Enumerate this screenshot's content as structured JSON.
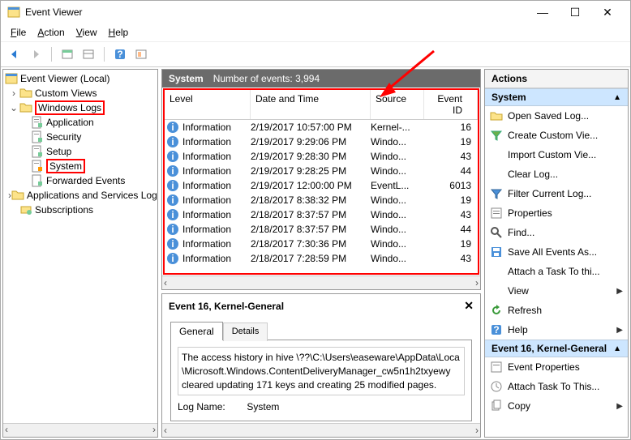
{
  "window": {
    "title": "Event Viewer"
  },
  "menubar": {
    "file": "File",
    "action": "Action",
    "view": "View",
    "help": "Help"
  },
  "tree": {
    "root": "Event Viewer (Local)",
    "custom_views": "Custom Views",
    "windows_logs": "Windows Logs",
    "application": "Application",
    "security": "Security",
    "setup": "Setup",
    "system": "System",
    "forwarded": "Forwarded Events",
    "apps_services": "Applications and Services Logs",
    "subscriptions": "Subscriptions"
  },
  "center_header": {
    "title": "System",
    "count_label": "Number of events:",
    "count": "3,994"
  },
  "columns": {
    "level": "Level",
    "datetime": "Date and Time",
    "source": "Source",
    "eventid": "Event ID"
  },
  "events": [
    {
      "level": "Information",
      "dt": "2/19/2017 10:57:00 PM",
      "src": "Kernel-...",
      "id": "16"
    },
    {
      "level": "Information",
      "dt": "2/19/2017 9:29:06 PM",
      "src": "Windo...",
      "id": "19"
    },
    {
      "level": "Information",
      "dt": "2/19/2017 9:28:30 PM",
      "src": "Windo...",
      "id": "43"
    },
    {
      "level": "Information",
      "dt": "2/19/2017 9:28:25 PM",
      "src": "Windo...",
      "id": "44"
    },
    {
      "level": "Information",
      "dt": "2/19/2017 12:00:00 PM",
      "src": "EventL...",
      "id": "6013"
    },
    {
      "level": "Information",
      "dt": "2/18/2017 8:38:32 PM",
      "src": "Windo...",
      "id": "19"
    },
    {
      "level": "Information",
      "dt": "2/18/2017 8:37:57 PM",
      "src": "Windo...",
      "id": "43"
    },
    {
      "level": "Information",
      "dt": "2/18/2017 8:37:57 PM",
      "src": "Windo...",
      "id": "44"
    },
    {
      "level": "Information",
      "dt": "2/18/2017 7:30:36 PM",
      "src": "Windo...",
      "id": "19"
    },
    {
      "level": "Information",
      "dt": "2/18/2017 7:28:59 PM",
      "src": "Windo...",
      "id": "43"
    }
  ],
  "detail": {
    "title": "Event 16, Kernel-General",
    "tab_general": "General",
    "tab_details": "Details",
    "message_l1": "The access history in hive \\??\\C:\\Users\\easeware\\AppData\\Loca",
    "message_l2": "\\Microsoft.Windows.ContentDeliveryManager_cw5n1h2txyewy",
    "message_l3": "cleared updating 171 keys and creating 25 modified pages.",
    "logname_label": "Log Name:",
    "logname_value": "System"
  },
  "actions": {
    "header": "Actions",
    "section1": "System",
    "open_saved": "Open Saved Log...",
    "create_custom": "Create Custom Vie...",
    "import_custom": "Import Custom Vie...",
    "clear_log": "Clear Log...",
    "filter": "Filter Current Log...",
    "properties": "Properties",
    "find": "Find...",
    "save_all": "Save All Events As...",
    "attach_task": "Attach a Task To thi...",
    "view": "View",
    "refresh": "Refresh",
    "help": "Help",
    "section2": "Event 16, Kernel-General",
    "event_props": "Event Properties",
    "attach_task2": "Attach Task To This...",
    "copy": "Copy"
  }
}
